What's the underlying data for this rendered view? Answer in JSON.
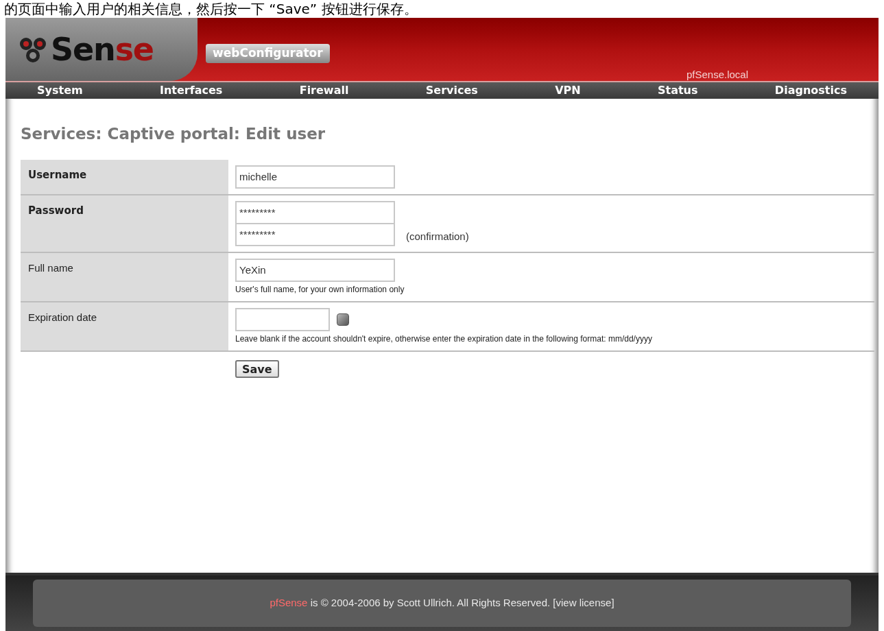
{
  "caption": "的页面中输入用户的相关信息，然后按一下 “Save” 按钮进行保存。",
  "header": {
    "logo": "Sense",
    "product": "webConfigurator",
    "hostname": "pfSense.local"
  },
  "nav": [
    {
      "label": "System"
    },
    {
      "label": "Interfaces"
    },
    {
      "label": "Firewall"
    },
    {
      "label": "Services"
    },
    {
      "label": "VPN"
    },
    {
      "label": "Status"
    },
    {
      "label": "Diagnostics"
    }
  ],
  "page_title": "Services: Captive portal: Edit user",
  "form": [
    {
      "kind": "text",
      "label": "Username",
      "required": true,
      "value": "michelle"
    },
    {
      "kind": "password",
      "label": "Password",
      "required": true,
      "value": "*********",
      "confirm_value": "*********",
      "note": "(confirmation)"
    },
    {
      "kind": "text",
      "label": "Full name",
      "required": false,
      "value": "YeXin",
      "hint": "User's full name, for your own information only"
    },
    {
      "kind": "date",
      "label": "Expiration date",
      "required": false,
      "hint": "Leave blank if the account shouldn't expire, otherwise enter the expiration date in the following format: mm/dd/yyyy"
    }
  ],
  "save_button": "Save",
  "footer": {
    "brand": "pfSense",
    "text": "is © 2004-2006 by Scott Ullrich. All Rights Reserved.",
    "link": "[view license]"
  }
}
